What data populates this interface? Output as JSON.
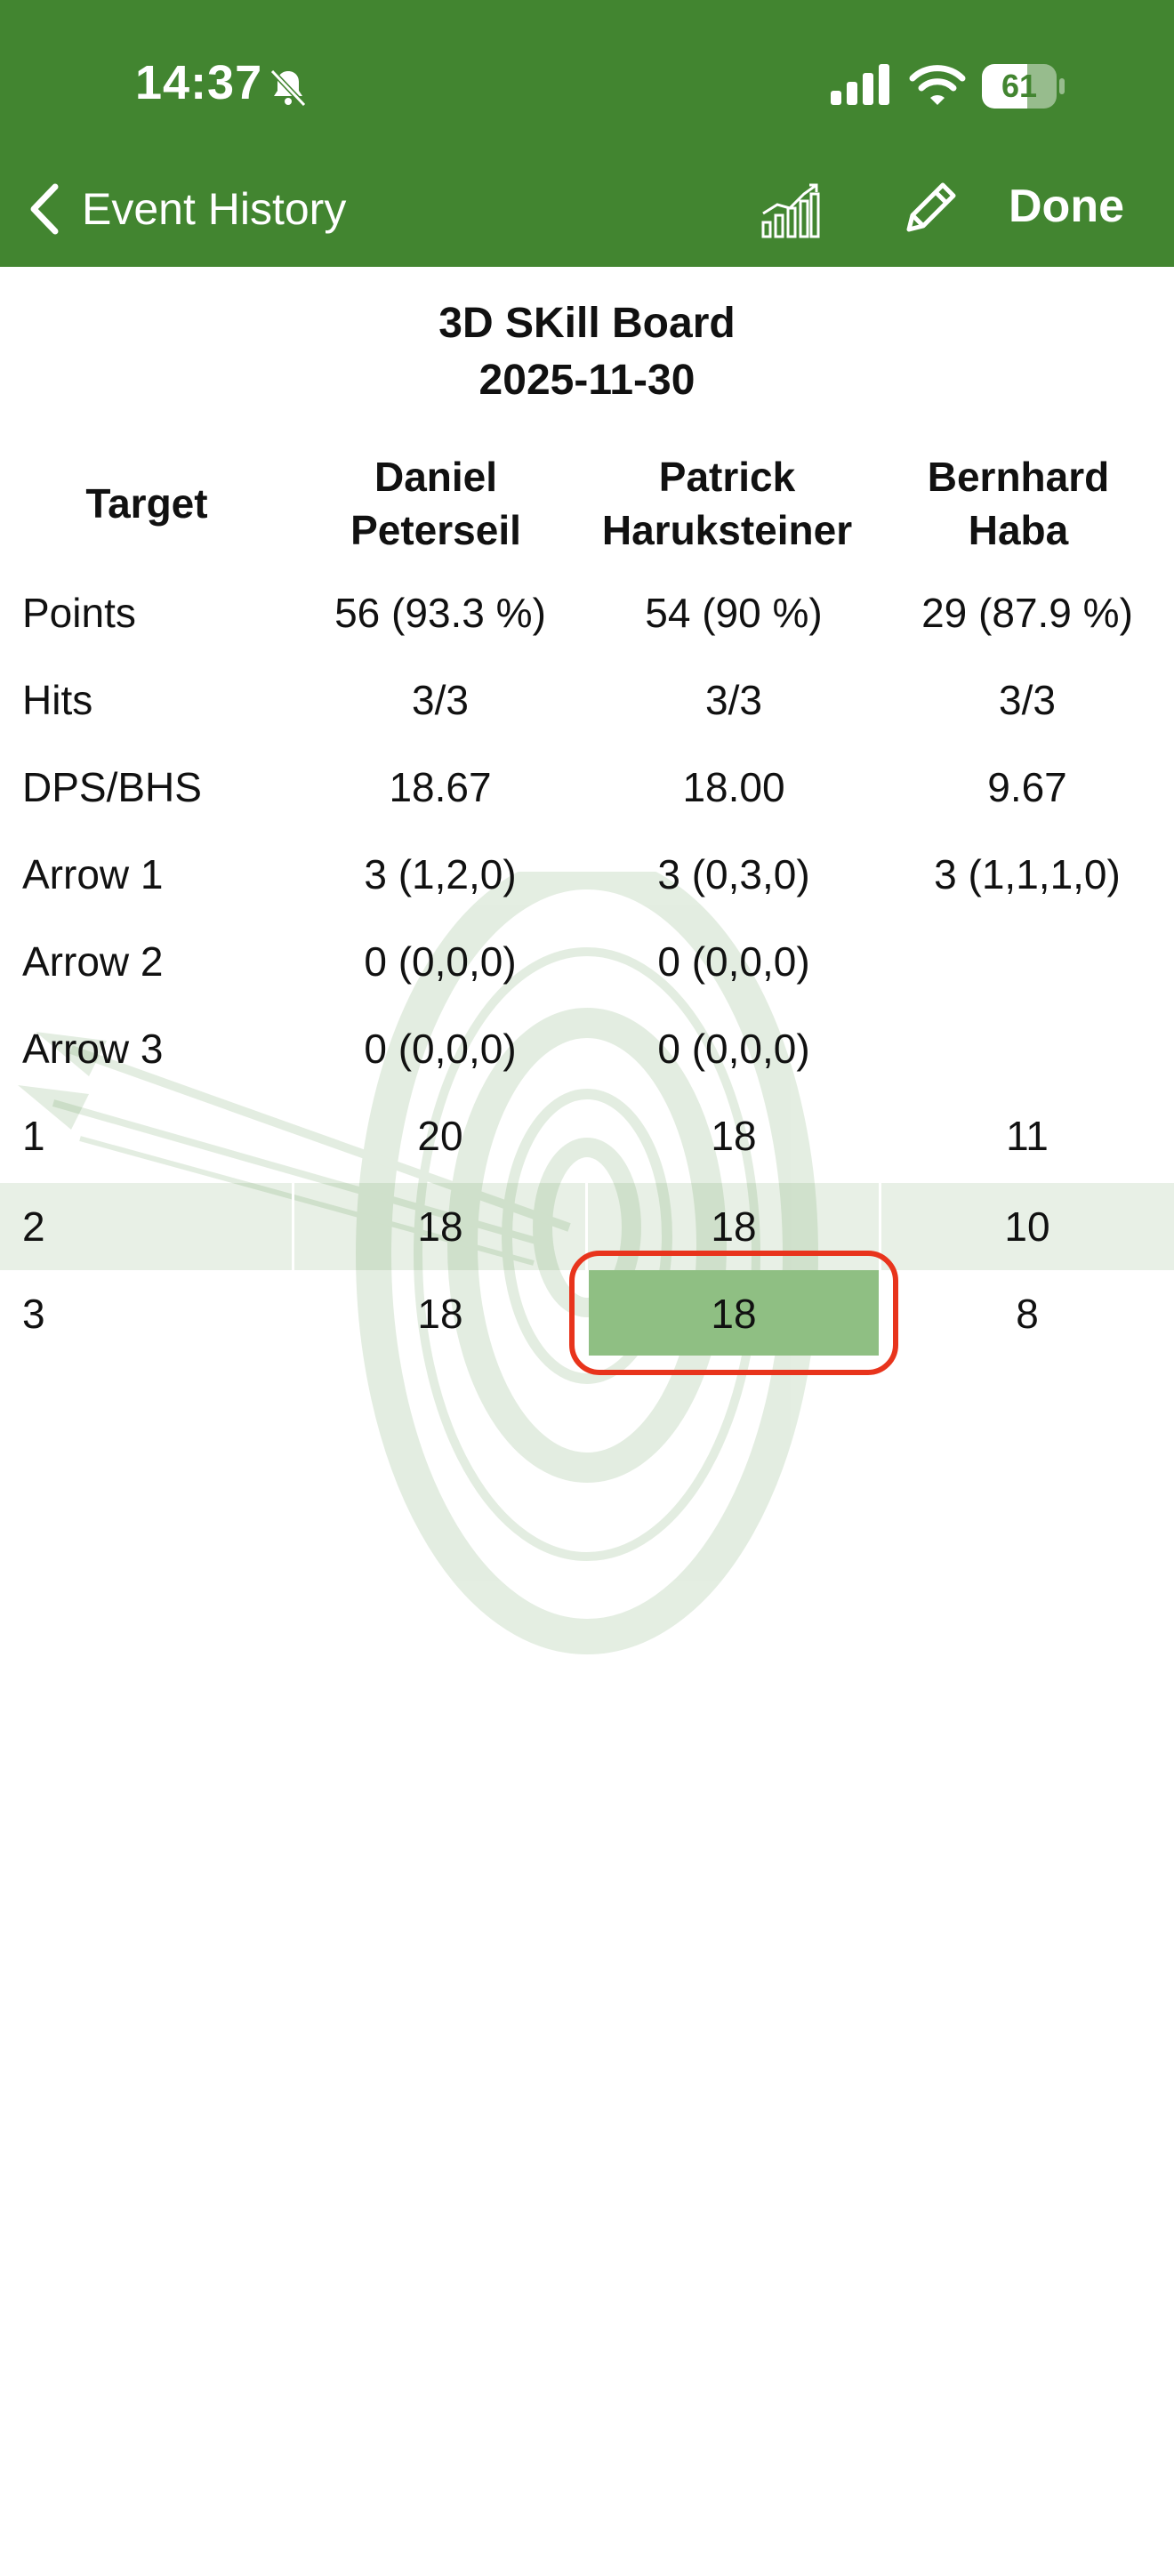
{
  "status_bar": {
    "time": "14:37",
    "battery": "61",
    "battery_level": 0.61
  },
  "nav": {
    "back_label": "Event History",
    "done_label": "Done"
  },
  "board": {
    "title": "3D SKill Board",
    "date": "2025-11-30"
  },
  "table": {
    "header_label": "Target",
    "players": [
      {
        "first": "Daniel",
        "last": "Peterseil"
      },
      {
        "first": "Patrick",
        "last": "Haruksteiner"
      },
      {
        "first": "Bernhard",
        "last": "Haba"
      }
    ],
    "rows": [
      {
        "label": "Points",
        "values": [
          "56 (93.3 %)",
          "54 (90 %)",
          "29 (87.9 %)"
        ]
      },
      {
        "label": "Hits",
        "values": [
          "3/3",
          "3/3",
          "3/3"
        ]
      },
      {
        "label": "DPS/BHS",
        "values": [
          "18.67",
          "18.00",
          "9.67"
        ]
      },
      {
        "label": "Arrow 1",
        "values": [
          "3 (1,2,0)",
          "3 (0,3,0)",
          "3 (1,1,1,0)"
        ]
      },
      {
        "label": "Arrow 2",
        "values": [
          "0 (0,0,0)",
          "0 (0,0,0)",
          ""
        ]
      },
      {
        "label": "Arrow 3",
        "values": [
          "0 (0,0,0)",
          "0 (0,0,0)",
          ""
        ]
      },
      {
        "label": "1",
        "values": [
          "20",
          "18",
          "11"
        ]
      },
      {
        "label": "2",
        "values": [
          "18",
          "18",
          "10"
        ]
      },
      {
        "label": "3",
        "values": [
          "18",
          "18",
          "8"
        ]
      }
    ]
  },
  "colors": {
    "header_green": "#428530",
    "selection_green": "#8fbf83",
    "highlight_red": "#e8341c"
  },
  "icons": [
    "bell-slash-icon",
    "cellular-signal-icon",
    "wifi-icon",
    "battery-icon",
    "chevron-left-icon",
    "chart-icon",
    "pencil-icon",
    "target-watermark-icon"
  ]
}
